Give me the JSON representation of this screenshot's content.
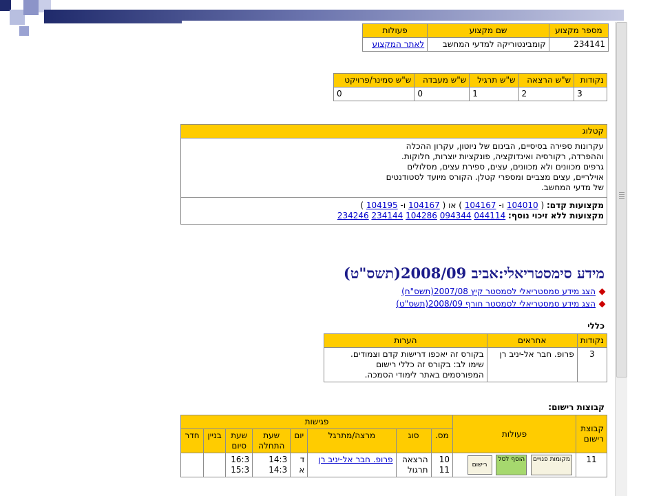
{
  "course": {
    "headers": [
      "מספר מקצוע",
      "שם מקצוע",
      "פעולות"
    ],
    "number": "234141",
    "name": "קומבינטוריקה למדעי המחשב",
    "site_link": "לאתר המקצוע"
  },
  "hours": {
    "headers": [
      "נקודות",
      "ש\"ש הרצאה",
      "ש\"ש תרגיל",
      "ש\"ש מעבדה",
      "ש\"ש סמינר/פרויקט"
    ],
    "values": [
      "3",
      "2",
      "1",
      "0",
      "0"
    ]
  },
  "catalog": {
    "header": "קטלוג",
    "lines": [
      "עקרונות ספירה בסיסיים, הבינום של ניוטון, עקרון ההכלה",
      "וההפרדה, רקורסיה ואינדוקציה, פונקציות יוצרות, חלוקות.",
      "גרפים מכוונים ולא מכוונים, עצים, ספירת עצים, מסלולים",
      "אוילריים, עצים מצביים ומספרי קטלן. הקורס מיועד לסטודנטים",
      "של מדעי המחשב."
    ],
    "prereq_label": "מקצועות קדם:",
    "prereq_parts": [
      "(",
      "104010",
      "ו-",
      "104167",
      ")",
      "או",
      "(",
      "104167",
      "ו-",
      "104195",
      ")"
    ],
    "nocredit_label": "מקצועות ללא זיכוי נוסף:",
    "nocredit": [
      "044114",
      "094344",
      "104286",
      "234144",
      "234246"
    ]
  },
  "semester": {
    "title": "מידע סימסטריאלי:אביב 2008/09(תשס\"ט)",
    "links": [
      "הצג מידע סמסטריאלי לסמסטר קיץ 2007/08(תשס\"ח)",
      "הצג מידע סמסטריאלי לסמסטר חורף 2008/09(תשס\"ט)"
    ]
  },
  "general": {
    "heading": "כללי",
    "headers": [
      "נקודות",
      "אחראים",
      "הערות"
    ],
    "points": "3",
    "responsible": "פרופ. חבר אל-יניב רן",
    "notes": [
      "בקורס זה יאכפו דרישות קדם וצמודים.",
      "שימו לב: בקורס זה כללי רישום",
      "המפורסמים באתר לימודי הסמכה."
    ]
  },
  "groups": {
    "heading": "קבוצות רישום:",
    "headers": {
      "group": "קבוצת רישום",
      "actions": "פעולות",
      "meetings": "פגישות",
      "num": "מס.",
      "type": "סוג",
      "lecturer": "מרצה/מתרגל",
      "day": "יום",
      "start": "שעת התחלה",
      "end": "שעת סיום",
      "building": "בניין",
      "room": "חדר"
    },
    "row": {
      "group": "11",
      "btn_places": "מקומות פנויים",
      "btn_add": "הוסף לסל",
      "btn_register": "רישום",
      "nums": [
        "10",
        "11"
      ],
      "types": [
        "הרצאה",
        "תרגול"
      ],
      "lecturer": "פרופ. חבר אל-יניב רן",
      "days": [
        "ד",
        "א"
      ],
      "starts": [
        "14:3",
        "14:3"
      ],
      "ends": [
        "16:3",
        "15:3"
      ]
    }
  }
}
